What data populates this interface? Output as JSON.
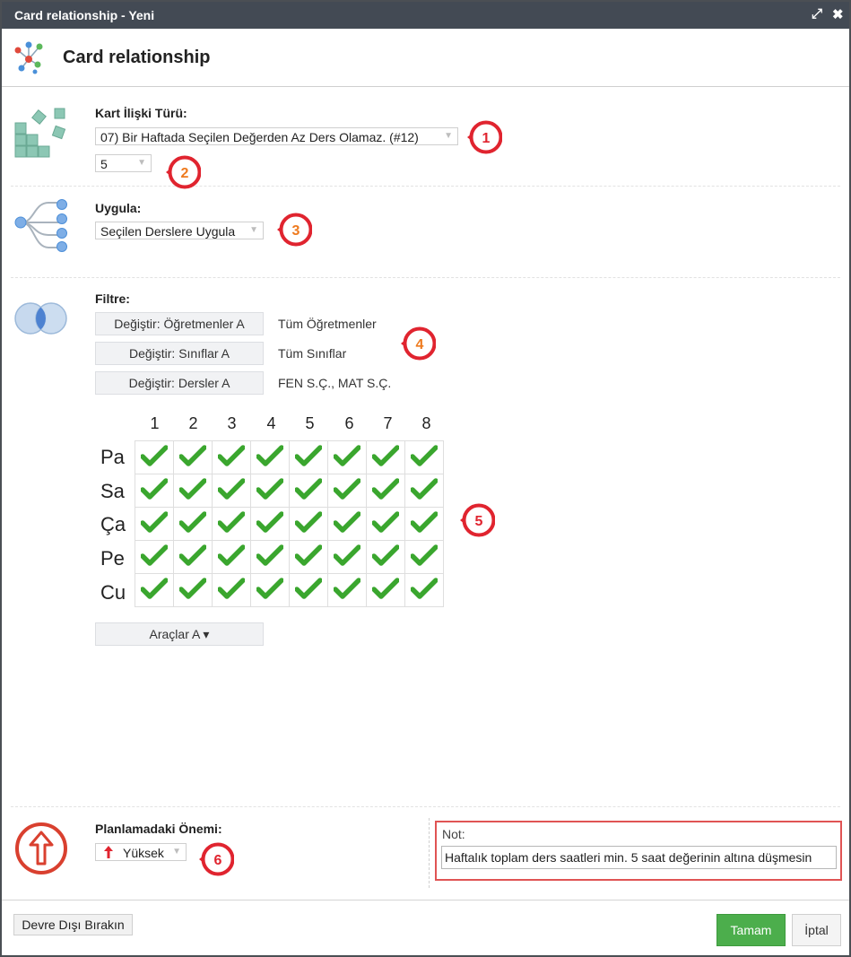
{
  "window": {
    "title": "Card relationship - Yeni"
  },
  "header": {
    "title": "Card relationship"
  },
  "card_type": {
    "label": "Kart İlişki Türü:",
    "selected": "07) Bir Haftada Seçilen Değerden Az Ders Olamaz. (#12)",
    "value_selected": "5"
  },
  "apply": {
    "label": "Uygula:",
    "selected": "Seçilen Derslere Uygula"
  },
  "filter": {
    "label": "Filtre:",
    "rows": [
      {
        "button": "Değiştir: Öğretmenler A",
        "value": "Tüm Öğretmenler"
      },
      {
        "button": "Değiştir: Sınıflar A",
        "value": "Tüm Sınıflar"
      },
      {
        "button": "Değiştir: Dersler A",
        "value": "FEN S.Ç., MAT S.Ç."
      }
    ]
  },
  "grid": {
    "columns": [
      "1",
      "2",
      "3",
      "4",
      "5",
      "6",
      "7",
      "8"
    ],
    "rows": [
      "Pa",
      "Sa",
      "Ça",
      "Pe",
      "Cu"
    ]
  },
  "tools_button": "Araçlar A ▾",
  "priority": {
    "label": "Planlamadaki Önemi:",
    "selected": "Yüksek"
  },
  "note": {
    "label": "Not:",
    "value": "Haftalık toplam ders saatleri min. 5 saat değerinin altına düşmesin"
  },
  "footer": {
    "disable": "Devre Dışı Bırakın",
    "ok": "Tamam",
    "cancel": "İptal"
  },
  "callouts": [
    "1",
    "2",
    "3",
    "4",
    "5",
    "6"
  ],
  "colors": {
    "titlebar": "#434a54",
    "check": "#3aa62e",
    "ok_button": "#4cae4c",
    "callout": "#e0242f",
    "note_border": "#e05454"
  }
}
